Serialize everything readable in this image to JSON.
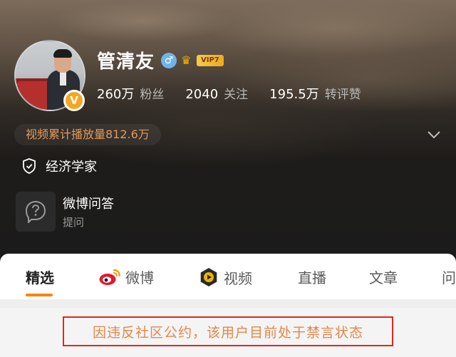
{
  "profile": {
    "name": "管清友",
    "gender_symbol": "♂",
    "vip_label": "VIP7",
    "verified_badge": "V"
  },
  "stats": [
    {
      "value": "260万",
      "label": "粉丝"
    },
    {
      "value": "2040",
      "label": "关注"
    },
    {
      "value": "195.5万",
      "label": "转评赞"
    }
  ],
  "play_count": "视频累计播放量812.6万",
  "certification": "经济学家",
  "qa": {
    "title": "微博问答",
    "subtitle": "提问"
  },
  "tabs": [
    {
      "label": "精选",
      "icon": null
    },
    {
      "label": "微博",
      "icon": "weibo-icon"
    },
    {
      "label": "视频",
      "icon": "video-icon"
    },
    {
      "label": "直播",
      "icon": null
    },
    {
      "label": "文章",
      "icon": null
    },
    {
      "label": "问",
      "icon": null
    }
  ],
  "notice": "因违反社区公约，该用户目前处于禁言状态",
  "colors": {
    "accent_orange": "#ff8200",
    "notice_border": "#e0281c",
    "notice_text": "#e3874a",
    "play_count_text": "#e39a57"
  }
}
